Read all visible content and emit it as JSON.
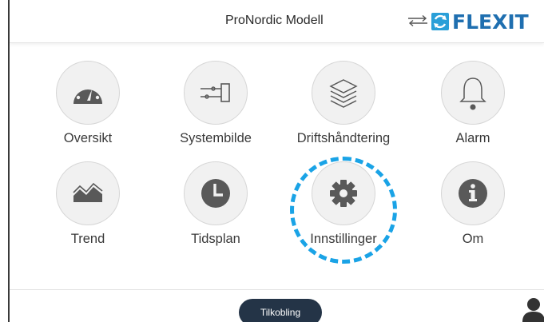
{
  "header": {
    "title": "ProNordic Modell",
    "brand": "FLEXIT",
    "swap_icon": "swap-arrows-icon"
  },
  "menu": {
    "tiles": [
      {
        "label": "Oversikt",
        "icon": "gauge-icon"
      },
      {
        "label": "Systembilde",
        "icon": "system-diagram-icon"
      },
      {
        "label": "Driftshåndtering",
        "icon": "layers-icon"
      },
      {
        "label": "Alarm",
        "icon": "bell-icon"
      },
      {
        "label": "Trend",
        "icon": "trend-chart-icon"
      },
      {
        "label": "Tidsplan",
        "icon": "clock-icon"
      },
      {
        "label": "Innstillinger",
        "icon": "gear-icon"
      },
      {
        "label": "Om",
        "icon": "info-icon"
      }
    ],
    "highlighted": "Innstillinger"
  },
  "footer": {
    "connect_label": "Tilkobling",
    "user_icon": "user-icon"
  },
  "colors": {
    "brand_blue": "#1f6fb0",
    "logo_mark": "#2a9fd8",
    "highlight": "#1aa3e6",
    "icon_dark": "#595959",
    "button_bg": "#243447"
  }
}
